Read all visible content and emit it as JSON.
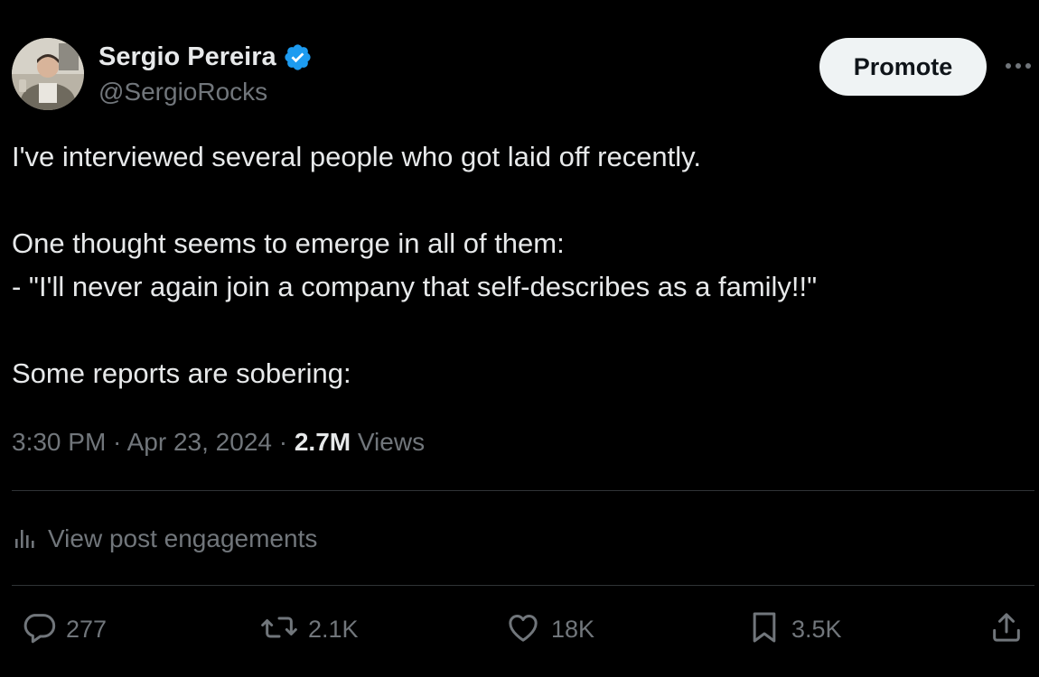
{
  "author": {
    "name": "Sergio Pereira",
    "handle": "@SergioRocks",
    "verified": true
  },
  "header": {
    "promote_label": "Promote"
  },
  "tweet": {
    "lines": [
      "I've interviewed several people who got laid off recently.",
      "",
      "One thought seems to emerge in all of them:",
      "- \"I'll never again join a company that self-describes as a family!!\"",
      "",
      "Some reports are sobering:"
    ]
  },
  "meta": {
    "time": "3:30 PM",
    "date": "Apr 23, 2024",
    "views_count": "2.7M",
    "views_label": "Views"
  },
  "engagements": {
    "label": "View post engagements"
  },
  "actions": {
    "replies": "277",
    "reposts": "2.1K",
    "likes": "18K",
    "bookmarks": "3.5K"
  },
  "colors": {
    "background": "#000000",
    "text": "#e7e9ea",
    "muted": "#71767b",
    "verified_blue": "#1d9bf0",
    "divider": "#2f3336"
  }
}
